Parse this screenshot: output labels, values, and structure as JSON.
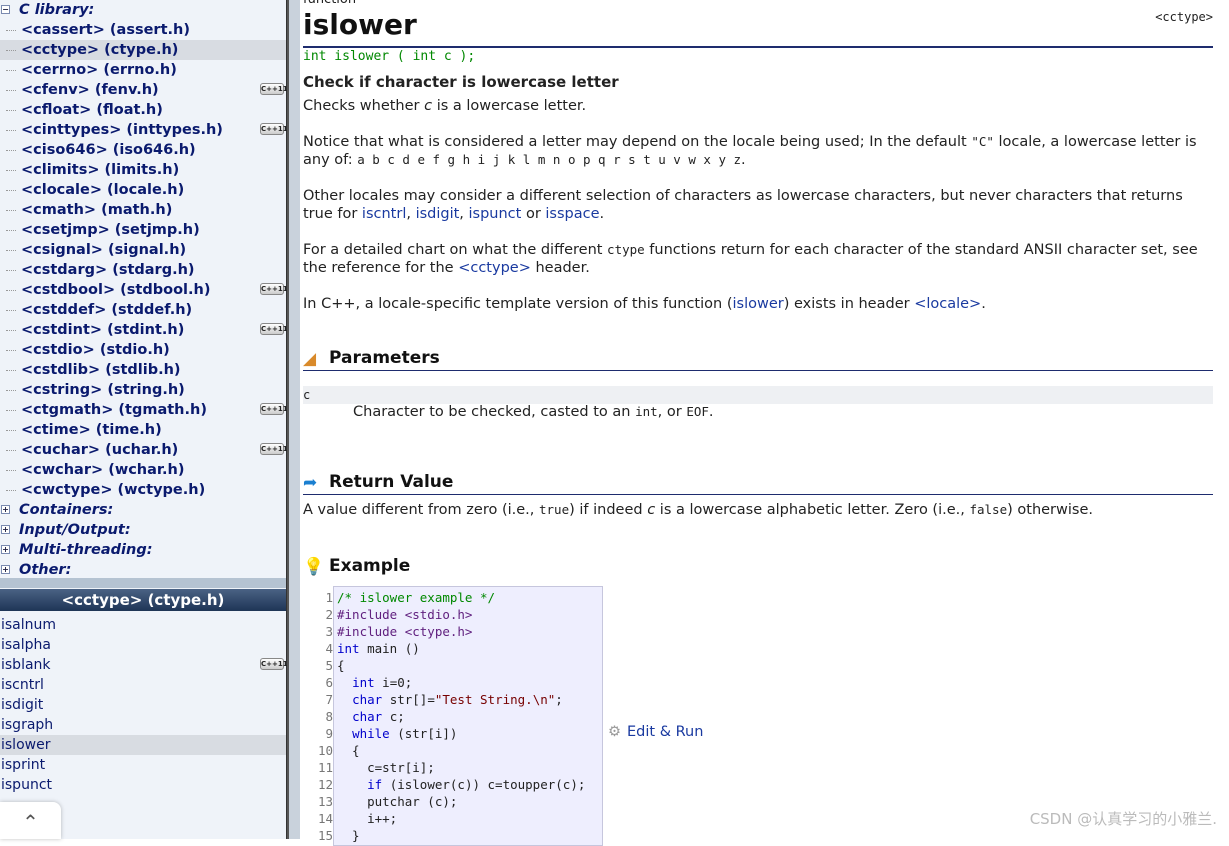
{
  "tree": [
    {
      "label": "C library:",
      "type": "cat",
      "expanded": true
    },
    {
      "label": "<cassert> (assert.h)"
    },
    {
      "label": "<cctype> (ctype.h)",
      "selected": true
    },
    {
      "label": "<cerrno> (errno.h)"
    },
    {
      "label": "<cfenv> (fenv.h)",
      "badge": "C++11"
    },
    {
      "label": "<cfloat> (float.h)"
    },
    {
      "label": "<cinttypes> (inttypes.h)",
      "badge": "C++11"
    },
    {
      "label": "<ciso646> (iso646.h)"
    },
    {
      "label": "<climits> (limits.h)"
    },
    {
      "label": "<clocale> (locale.h)"
    },
    {
      "label": "<cmath> (math.h)"
    },
    {
      "label": "<csetjmp> (setjmp.h)"
    },
    {
      "label": "<csignal> (signal.h)"
    },
    {
      "label": "<cstdarg> (stdarg.h)"
    },
    {
      "label": "<cstdbool> (stdbool.h)",
      "badge": "C++11"
    },
    {
      "label": "<cstddef> (stddef.h)"
    },
    {
      "label": "<cstdint> (stdint.h)",
      "badge": "C++11"
    },
    {
      "label": "<cstdio> (stdio.h)"
    },
    {
      "label": "<cstdlib> (stdlib.h)"
    },
    {
      "label": "<cstring> (string.h)"
    },
    {
      "label": "<ctgmath> (tgmath.h)",
      "badge": "C++11"
    },
    {
      "label": "<ctime> (time.h)"
    },
    {
      "label": "<cuchar> (uchar.h)",
      "badge": "C++11"
    },
    {
      "label": "<cwchar> (wchar.h)"
    },
    {
      "label": "<cwctype> (wctype.h)"
    },
    {
      "label": "Containers:",
      "type": "cat"
    },
    {
      "label": "Input/Output:",
      "type": "cat"
    },
    {
      "label": "Multi-threading:",
      "type": "cat"
    },
    {
      "label": "Other:",
      "type": "cat"
    }
  ],
  "sub_header": "<cctype> (ctype.h)",
  "functions": [
    {
      "label": "isalnum"
    },
    {
      "label": "isalpha"
    },
    {
      "label": "isblank",
      "badge": "C++11"
    },
    {
      "label": "iscntrl"
    },
    {
      "label": "isdigit"
    },
    {
      "label": "isgraph"
    },
    {
      "label": "islower",
      "selected": true
    },
    {
      "label": "isprint"
    },
    {
      "label": "ispunct"
    }
  ],
  "page": {
    "kind": "function",
    "title": "islower",
    "header_ref": "<cctype>",
    "prototype": "int islower ( int c );",
    "summary": "Check if character is lowercase letter",
    "p1_a": "Checks whether ",
    "p1_c": "c",
    "p1_b": " is a lowercase letter.",
    "p2_a": "Notice that what is considered a letter may depend on the locale being used; In the default ",
    "p2_c": "\"C\"",
    "p2_b": " locale, a lowercase letter is any of: ",
    "p2_letters": "a b c d e f g h i j k l m n o p q r s t u v w x y z",
    "p2_end": ".",
    "p3_a": "Other locales may consider a different selection of characters as lowercase characters, but never characters that returns true for ",
    "l_iscntrl": "iscntrl",
    "sep1": ", ",
    "l_isdigit": "isdigit",
    "sep2": ", ",
    "l_ispunct": "ispunct",
    "p3_or": " or ",
    "l_isspace": "isspace",
    "p3_end": ".",
    "p4_a": "For a detailed chart on what the different ",
    "p4_c": "ctype",
    "p4_b": " functions return for each character of the standard ANSII character set, see the reference for the ",
    "l_cctype": "<cctype>",
    "p4_end": " header.",
    "p5_a": "In C++, a locale-specific template version of this function (",
    "l_islower": "islower",
    "p5_b": ") exists in header ",
    "l_locale": "<locale>",
    "p5_end": ".",
    "params_title": "Parameters",
    "param_name": "c",
    "param_desc_a": "Character to be checked, casted to an ",
    "param_int": "int",
    "param_or": ", or ",
    "param_eof": "EOF",
    "param_end": ".",
    "return_title": "Return Value",
    "ret_a": "A value different from zero (i.e., ",
    "ret_true": "true",
    "ret_b": ") if indeed ",
    "ret_c": "c",
    "ret_d": " is a lowercase alphabetic letter. Zero (i.e., ",
    "ret_false": "false",
    "ret_e": ") otherwise.",
    "example_title": "Example",
    "edit_run": "Edit & Run"
  },
  "code": [
    [
      [
        "cm",
        "/* islower example */"
      ]
    ],
    [
      [
        "pp",
        "#include <stdio.h>"
      ]
    ],
    [
      [
        "pp",
        "#include <ctype.h>"
      ]
    ],
    [
      [
        "kw",
        "int"
      ],
      [
        "tx",
        " main ()"
      ]
    ],
    [
      [
        "tx",
        "{"
      ]
    ],
    [
      [
        "tx",
        "  "
      ],
      [
        "kw",
        "int"
      ],
      [
        "tx",
        " i=0;"
      ]
    ],
    [
      [
        "tx",
        "  "
      ],
      [
        "kw",
        "char"
      ],
      [
        "tx",
        " str[]="
      ],
      [
        "st",
        "\"Test String.\\n\""
      ],
      [
        "tx",
        ";"
      ]
    ],
    [
      [
        "tx",
        "  "
      ],
      [
        "kw",
        "char"
      ],
      [
        "tx",
        " c;"
      ]
    ],
    [
      [
        "tx",
        "  "
      ],
      [
        "kw",
        "while"
      ],
      [
        "tx",
        " (str[i])"
      ]
    ],
    [
      [
        "tx",
        "  {"
      ]
    ],
    [
      [
        "tx",
        "    c=str[i];"
      ]
    ],
    [
      [
        "tx",
        "    "
      ],
      [
        "kw",
        "if"
      ],
      [
        "tx",
        " (islower(c)) c=toupper(c);"
      ]
    ],
    [
      [
        "tx",
        "    putchar (c);"
      ]
    ],
    [
      [
        "tx",
        "    i++;"
      ]
    ],
    [
      [
        "tx",
        "  }"
      ]
    ]
  ],
  "watermark": "CSDN @认真学习的小雅兰."
}
